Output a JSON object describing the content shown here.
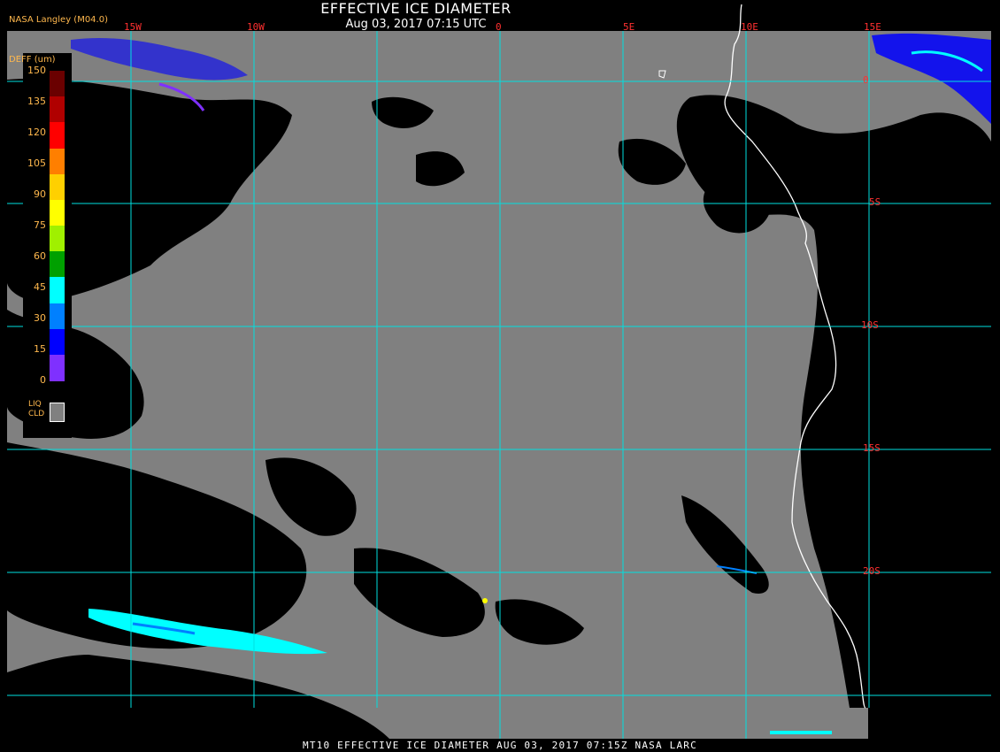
{
  "header": {
    "title": "EFFECTIVE ICE DIAMETER",
    "subtitle": "Aug 03, 2017 07:15 UTC",
    "source": "NASA Langley (M04.0)"
  },
  "footer": {
    "text": "MT10  EFFECTIVE ICE DIAMETER  AUG 03, 2017 07:15Z  NASA LARC"
  },
  "legend": {
    "title": "DEFF (um)",
    "ticks": [
      "150",
      "135",
      "120",
      "105",
      "90",
      "75",
      "60",
      "45",
      "30",
      "15",
      "0"
    ],
    "colors": [
      "#6a0000",
      "#b00000",
      "#ff0000",
      "#ff7f00",
      "#ffd000",
      "#ffff00",
      "#a0f000",
      "#00a000",
      "#00ffff",
      "#0080ff",
      "#0000ff",
      "#7f30ff"
    ],
    "liquid_label_line1": "LIQ",
    "liquid_label_line2": "CLD",
    "liquid_color": "#808080"
  },
  "map": {
    "lon_labels": [
      "15W",
      "10W",
      "0",
      "5E",
      "10E",
      "15E"
    ],
    "lat_labels": [
      "0",
      "5S",
      "10S",
      "15S",
      "20S"
    ],
    "colors": {
      "liquid_cloud": "#808080",
      "clear": "#000000",
      "grid": "#00e0e0",
      "coast": "#ffffff",
      "label": "#ff3030"
    }
  }
}
